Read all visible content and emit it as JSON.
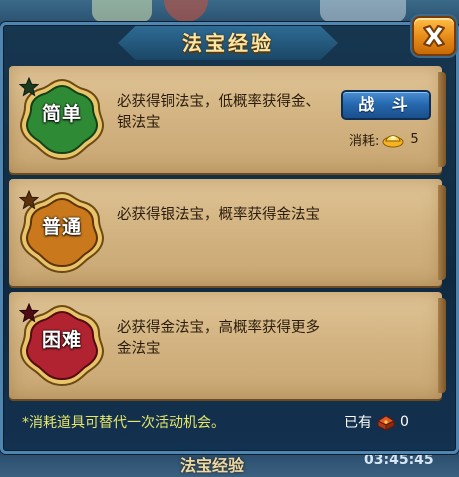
{
  "window": {
    "title": "法宝经验",
    "background_title": "法宝经验",
    "background_timer": "03:45:45"
  },
  "levels": [
    {
      "badge": "简单",
      "badge_color": "#2f8a35",
      "description": "必获得铜法宝，低概率获得金、银法宝",
      "action_label": "战 斗",
      "cost_label": "消耗:",
      "cost_icon": "gold-ingot-icon",
      "cost_value": "5"
    },
    {
      "badge": "普通",
      "badge_color": "#c9781c",
      "description": "必获得银法宝，概率获得金法宝"
    },
    {
      "badge": "困难",
      "badge_color": "#b12330",
      "description": "必获得金法宝，高概率获得更多金法宝"
    }
  ],
  "footer": {
    "note": "*消耗道具可替代一次活动机会。",
    "owned_label": "已有",
    "owned_icon": "treasure-chest-icon",
    "owned_value": "0"
  }
}
